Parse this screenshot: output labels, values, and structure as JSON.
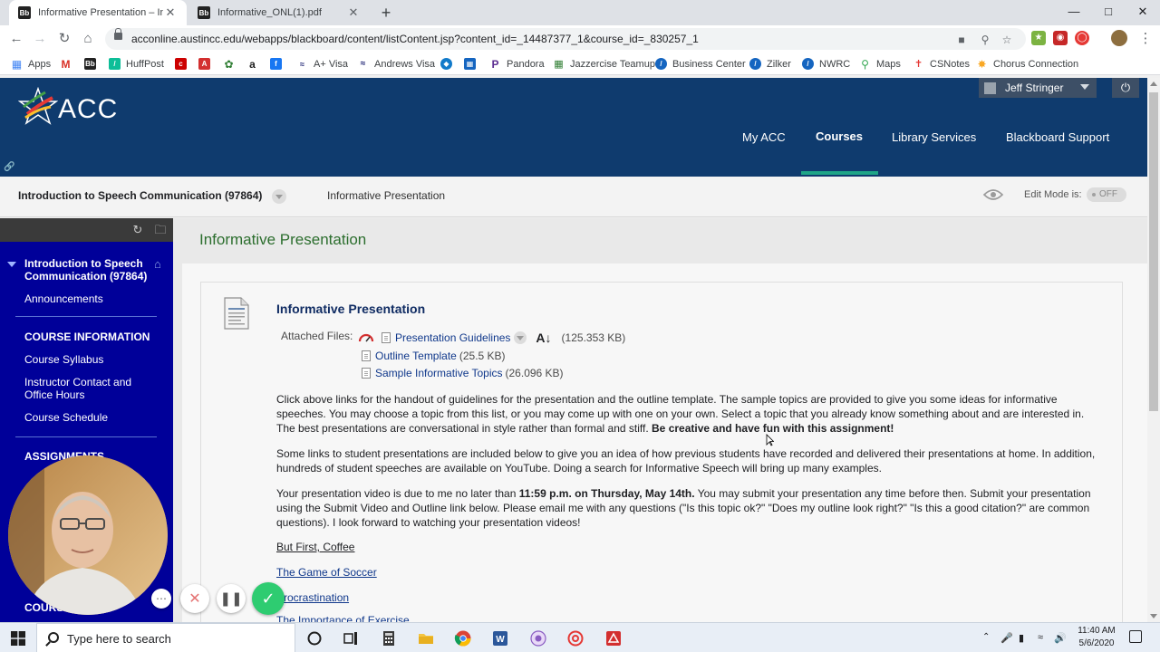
{
  "browser": {
    "tabs": [
      {
        "title": "Informative Presentation – In",
        "favicon": "Bb",
        "active": true
      },
      {
        "title": "Informative_ONL(1).pdf",
        "favicon": "Bb",
        "active": false
      }
    ],
    "new_tab_label": "+",
    "url": "acconline.austincc.edu/webapps/blackboard/content/listContent.jsp?content_id=_14487377_1&course_id=_830257_1",
    "bookmarks": [
      {
        "label": "Apps",
        "icon": "apps-grid-icon",
        "color": "#4285f4"
      },
      {
        "label": "",
        "icon": "gmail-icon",
        "color": "#d93025"
      },
      {
        "label": "",
        "icon": "blackboard-icon",
        "color": "#222222"
      },
      {
        "label": "HuffPost",
        "icon": "huffpost-icon",
        "color": "#0dbe98"
      },
      {
        "label": "",
        "icon": "cnn-icon",
        "color": "#cc0000"
      },
      {
        "label": "",
        "icon": "acrobat-icon",
        "color": "#d32f2f"
      },
      {
        "label": "",
        "icon": "leaf-icon",
        "color": "#2e7d32"
      },
      {
        "label": "",
        "icon": "amazon-icon",
        "color": "#222222"
      },
      {
        "label": "",
        "icon": "facebook-icon",
        "color": "#1877f2"
      },
      {
        "label": "A+ Visa",
        "icon": "visa-icon",
        "color": "#1a1f71"
      },
      {
        "label": "Andrews Visa",
        "icon": "visa-wave-icon",
        "color": "#1a1f71"
      },
      {
        "label": "",
        "icon": "chase-icon",
        "color": "#117aca"
      },
      {
        "label": "",
        "icon": "building-icon",
        "color": "#1565c0"
      },
      {
        "label": "Pandora",
        "icon": "pandora-icon",
        "color": "#5c2d91"
      },
      {
        "label": "Jazzercise Teamup",
        "icon": "teamup-icon",
        "color": "#2e7d32"
      },
      {
        "label": "Business Center",
        "icon": "business-icon",
        "color": "#1565c0"
      },
      {
        "label": "Zilker",
        "icon": "zilker-icon",
        "color": "#1565c0"
      },
      {
        "label": "NWRC",
        "icon": "nwrc-icon",
        "color": "#1565c0"
      },
      {
        "label": "Maps",
        "icon": "maps-pin-icon",
        "color": "#34a853"
      },
      {
        "label": "CSNotes",
        "icon": "csnotes-icon",
        "color": "#e53935"
      },
      {
        "label": "Chorus Connection",
        "icon": "chorus-icon",
        "color": "#f9a825"
      }
    ]
  },
  "header": {
    "logo_text": "ACC",
    "user_name": "Jeff Stringer",
    "nav": [
      {
        "label": "My ACC",
        "active": false
      },
      {
        "label": "Courses",
        "active": true
      },
      {
        "label": "Library Services",
        "active": false
      },
      {
        "label": "Blackboard Support",
        "active": false
      }
    ],
    "accent_color": "#1ea587",
    "bg_color": "#0f3b6e"
  },
  "breadcrumb": {
    "course": "Introduction to Speech Communication (97864)",
    "page": "Informative Presentation",
    "edit_mode_label": "Edit Mode is:",
    "edit_mode_state": "OFF"
  },
  "course_menu": {
    "course_title": "Introduction to Speech Communication (97864)",
    "items": [
      {
        "label": "Announcements",
        "type": "link"
      },
      {
        "label": "COURSE INFORMATION",
        "type": "header"
      },
      {
        "label": "Course Syllabus",
        "type": "link"
      },
      {
        "label": "Instructor Contact and Office Hours",
        "type": "link"
      },
      {
        "label": "Course Schedule",
        "type": "link"
      },
      {
        "label": "ASSIGNMENTS",
        "type": "header"
      },
      {
        "label": "COURS",
        "type": "header"
      }
    ],
    "bg_color": "#000099"
  },
  "content": {
    "page_title": "Informative Presentation",
    "item_title": "Informative Presentation",
    "attached_label": "Attached Files:",
    "files": [
      {
        "name": "Presentation Guidelines",
        "size": "(125.353 KB)"
      },
      {
        "name": "Outline Template",
        "size": "(25.5 KB)"
      },
      {
        "name": "Sample Informative Topics",
        "size": "(26.096 KB)"
      }
    ],
    "para1": "Click above links for the handout of guidelines for the presentation and the outline template. The sample topics are provided to give you some ideas for informative speeches. You may choose a topic from this list, or you may come up with one on your own. Select a topic that you already know something about and are interested in. The best presentations are conversational in style rather than formal and stiff.",
    "para1_bold": "Be creative and have fun with this assignment!",
    "para2": "Some links to student presentations are included below to give you an idea of how previous students have recorded and delivered their presentations at home. In addition, hundreds of student speeches are available on YouTube. Doing a search for Informative Speech will bring up many examples.",
    "para3_pre": "Your presentation video is due to me no later than",
    "para3_bold": "11:59 p.m. on Thursday, May 14th.",
    "para3_post": "You may submit your presentation any time before then. Submit your presentation using the Submit Video and Outline link below. Please email me with any questions (\"Is this topic ok?\" \"Does my outline look right?\" \"Is this a good citation?\" are common questions). I look forward to watching your presentation videos!",
    "links": [
      {
        "label": "But First, Coffee"
      },
      {
        "label": "The Game of Soccer"
      },
      {
        "label": "Procrastination"
      },
      {
        "label": "The Importance of Exercise"
      }
    ]
  },
  "recorder": {
    "buttons": [
      "more-options",
      "cancel",
      "pause",
      "finish"
    ]
  },
  "taskbar": {
    "search_placeholder": "Type here to search",
    "time": "11:40 AM",
    "date": "5/6/2020"
  }
}
